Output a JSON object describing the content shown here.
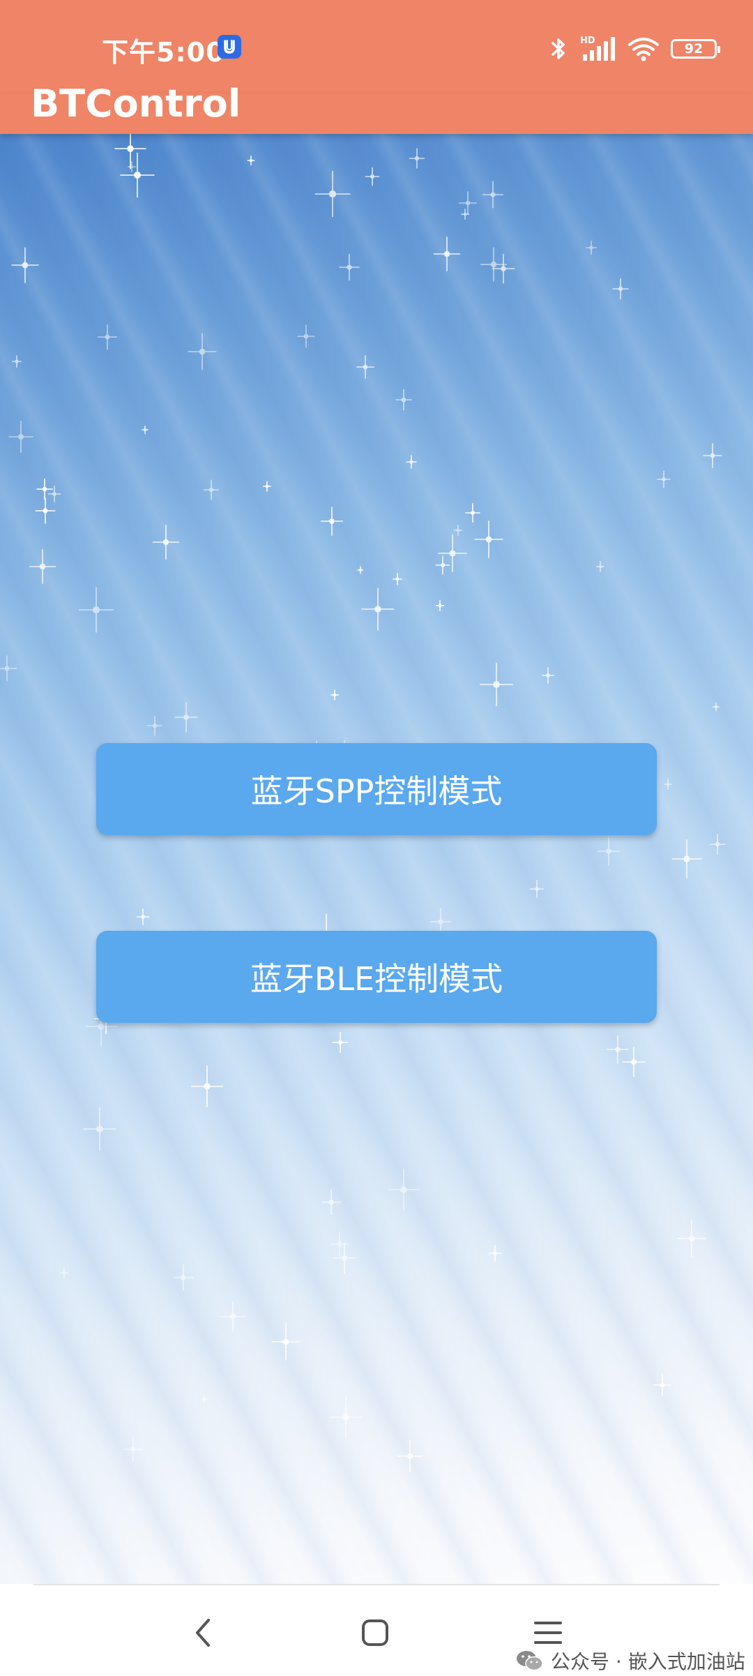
{
  "status_bar": {
    "time": "下午5:00",
    "network_label": "HD",
    "battery_level": "92"
  },
  "app_bar": {
    "title": "BTControl"
  },
  "buttons": {
    "spp_label": "蓝牙SPP控制模式",
    "ble_label": "蓝牙BLE控制模式"
  },
  "watermark": {
    "text": "公众号 · 嵌入式加油站"
  },
  "icons": {
    "alarm": "alarm-app-icon",
    "bluetooth": "bluetooth-icon",
    "signal": "signal-icon",
    "wifi": "wifi-icon",
    "battery": "battery-icon",
    "back": "back-chevron-icon",
    "home": "home-square-icon",
    "menu": "menu-lines-icon",
    "wechat": "wechat-icon"
  },
  "colors": {
    "app_bar": "#EF8466",
    "button": "#5AA8EE",
    "button_text": "#FFFFFF",
    "alarm_icon": "#2D6BE4"
  }
}
